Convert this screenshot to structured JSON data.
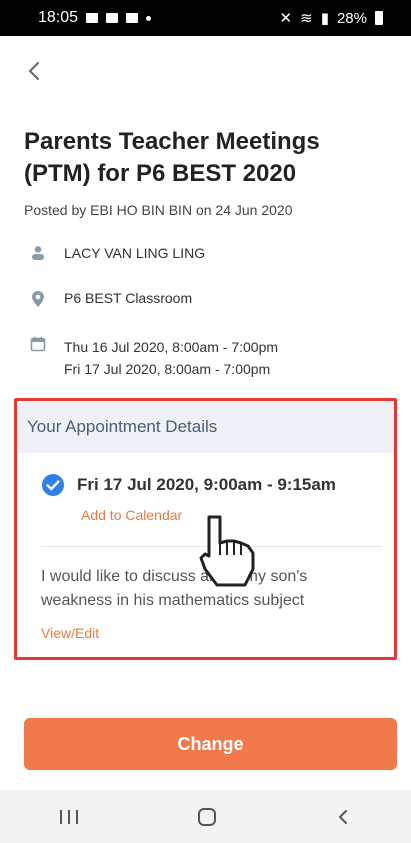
{
  "status_bar": {
    "time": "18:05",
    "battery_percent": "28%"
  },
  "page": {
    "title": "Parents Teacher Meetings (PTM) for P6 BEST 2020",
    "posted_by": "Posted by EBI HO BIN BIN on 24 Jun 2020"
  },
  "details": {
    "teacher": "LACY VAN LING LING",
    "venue": "P6 BEST Classroom",
    "dates": [
      "Thu 16 Jul 2020, 8:00am - 7:00pm",
      "Fri 17 Jul 2020, 8:00am - 7:00pm"
    ]
  },
  "appointment": {
    "header": "Your Appointment Details",
    "time": "Fri 17 Jul 2020, 9:00am - 9:15am",
    "add_to_calendar": "Add to Calendar",
    "note": "I would like to discuss about my son's weakness in his mathematics subject",
    "view_edit": "View/Edit"
  },
  "actions": {
    "change": "Change"
  },
  "icons": {
    "back": "chevron-left-icon",
    "person": "person-icon",
    "location": "location-pin-icon",
    "calendar": "calendar-icon",
    "check": "check-circle-icon",
    "hand": "pointing-hand-icon"
  },
  "colors": {
    "accent": "#f07a4c",
    "link": "#e87a46",
    "highlight_border": "#e53935",
    "check_blue": "#2f80ed",
    "header_bg": "#eef2f6"
  }
}
